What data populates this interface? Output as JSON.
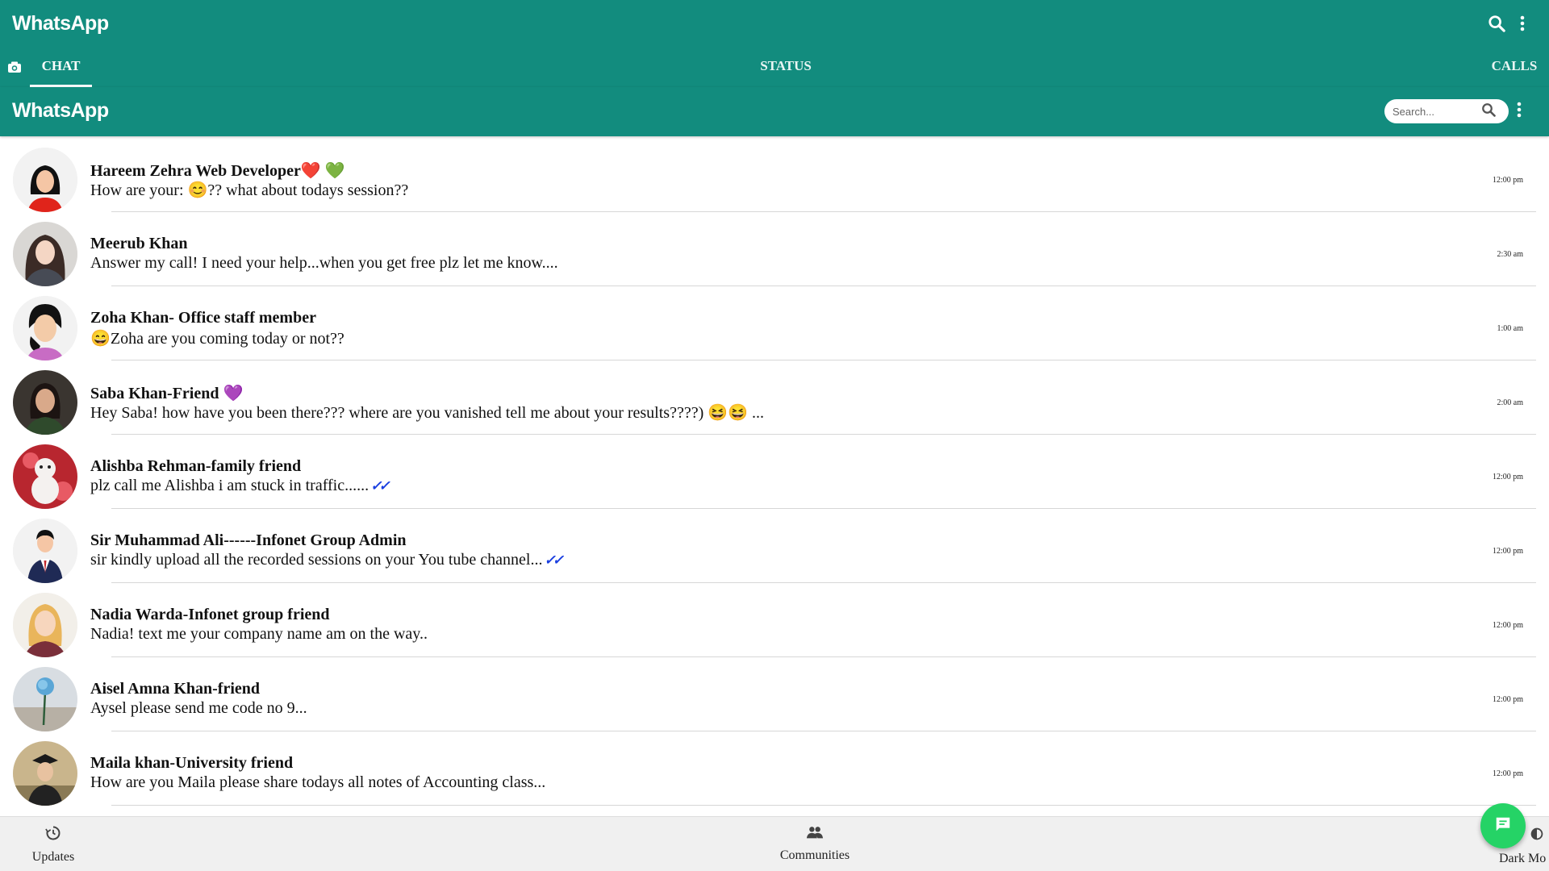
{
  "app": {
    "title": "WhatsApp",
    "accent": "#128c7e",
    "fab_color": "#25d366",
    "tick_color": "#1a3fe0"
  },
  "header": {
    "title": "WhatsApp",
    "icons": [
      "search-icon",
      "more-vertical-icon"
    ]
  },
  "tabs": [
    {
      "label": "CHAT",
      "active": true
    },
    {
      "label": "STATUS",
      "active": false
    },
    {
      "label": "CALLS",
      "active": false
    }
  ],
  "subheader": {
    "title": "WhatsApp",
    "search_placeholder": "Search..."
  },
  "chats": [
    {
      "name": "Hareem Zehra Web Developer❤️ 💚",
      "message": "How are your: 😊?? what about todays session??",
      "time": "12:00 pm",
      "ticks": ""
    },
    {
      "name": "Meerub Khan",
      "message": "Answer my call! I need your help...when you get free plz let me know....",
      "time": "2:30 am",
      "ticks": ""
    },
    {
      "name": "Zoha Khan- Office staff member",
      "message": "😄Zoha are you coming today or not??",
      "time": "1:00 am",
      "ticks": ""
    },
    {
      "name": "Saba Khan-Friend 💜",
      "message": "Hey Saba! how have you been there??? where are you vanished tell me about your results????) 😆😆 ...",
      "time": "2:00 am",
      "ticks": ""
    },
    {
      "name": "Alishba Rehman-family friend",
      "message": "plz call me Alishba i am stuck in traffic......",
      "time": "12:00 pm",
      "ticks": "✓✓"
    },
    {
      "name": "Sir Muhammad Ali------Infonet Group Admin",
      "message": "sir kindly upload all the recorded sessions on your You tube channel...",
      "time": "12:00 pm",
      "ticks": "✓✓"
    },
    {
      "name": "Nadia Warda-Infonet group friend",
      "message": "Nadia! text me your company name am on the way..",
      "time": "12:00 pm",
      "ticks": ""
    },
    {
      "name": "Aisel Amna Khan-friend",
      "message": "Aysel please send me code no 9...",
      "time": "12:00 pm",
      "ticks": ""
    },
    {
      "name": "Maila khan-University friend",
      "message": "How are you Maila please share todays all notes of Accounting class...",
      "time": "12:00 pm",
      "ticks": ""
    }
  ],
  "bottom_nav": [
    {
      "label": "Updates",
      "icon": "updates-icon"
    },
    {
      "label": "Communities",
      "icon": "communities-icon"
    },
    {
      "label": "Dark Mo",
      "icon": "dark-mode-icon"
    }
  ],
  "fab": {
    "icon": "new-chat-icon"
  }
}
